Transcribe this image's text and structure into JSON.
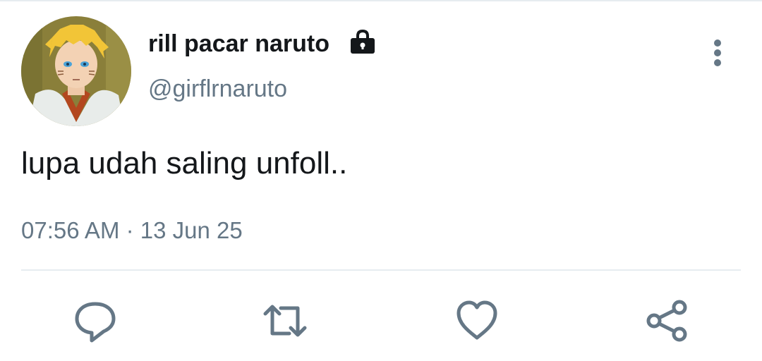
{
  "tweet": {
    "display_name": "rill pacar naruto",
    "handle": "@girflrnaruto",
    "text": "lupa udah saling unfoll..",
    "timestamp": "07:56 AM · 13 Jun 25",
    "protected": true
  },
  "icons": {
    "lock": "lock-icon",
    "more": "more-vertical-icon",
    "reply": "reply-icon",
    "retweet": "retweet-icon",
    "like": "heart-icon",
    "share": "share-icon"
  },
  "colors": {
    "text_primary": "#14171a",
    "text_secondary": "#657786",
    "icon": "#657786",
    "divider": "#e6ecf0",
    "background": "#ffffff"
  }
}
